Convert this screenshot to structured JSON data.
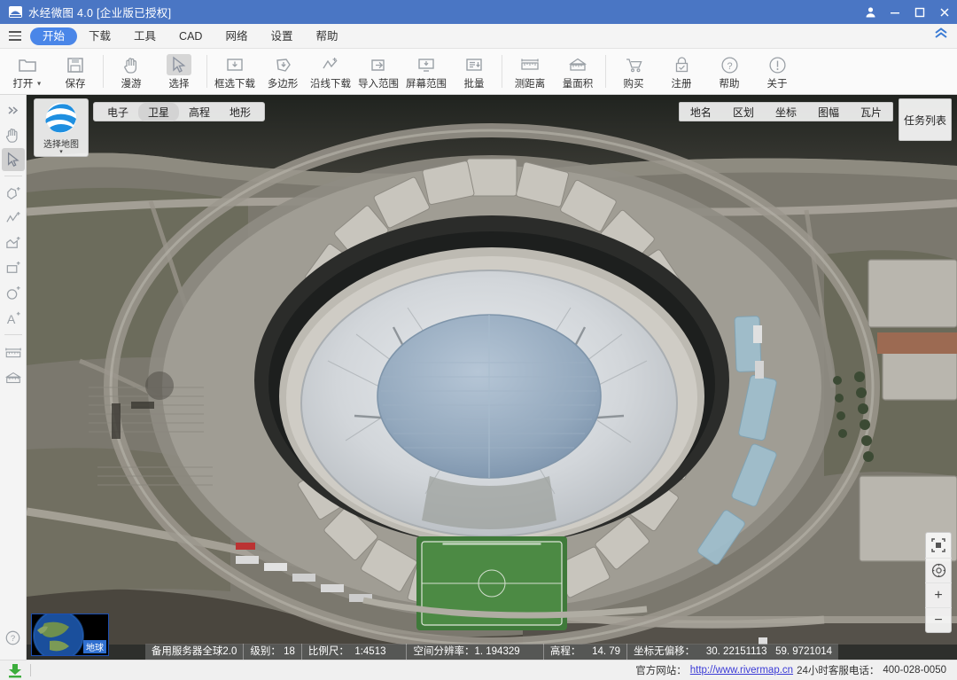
{
  "window": {
    "title": "水经微图 4.0 [企业版已授权]",
    "logo_icon": "app-logo-icon",
    "controls": [
      {
        "name": "user-account-icon",
        "glyph": "♟"
      },
      {
        "name": "minimize-button",
        "glyph": "—"
      },
      {
        "name": "maximize-button",
        "glyph": "□"
      },
      {
        "name": "close-button",
        "glyph": "✕"
      }
    ]
  },
  "menubar": {
    "hamburger_name": "hamburger-menu-icon",
    "items": [
      {
        "label": "开始",
        "active": true
      },
      {
        "label": "下载",
        "active": false
      },
      {
        "label": "工具",
        "active": false
      },
      {
        "label": "CAD",
        "active": false
      },
      {
        "label": "网络",
        "active": false
      },
      {
        "label": "设置",
        "active": false
      },
      {
        "label": "帮助",
        "active": false
      }
    ],
    "collapse_glyph": "∧̲"
  },
  "ribbon": {
    "items": [
      {
        "label": "打开",
        "icon": "folder-open-icon",
        "dropdown": true,
        "selected": false
      },
      {
        "label": "保存",
        "icon": "save-disk-icon",
        "dropdown": false,
        "selected": false
      },
      {
        "sep": true
      },
      {
        "label": "漫游",
        "icon": "pan-hand-icon",
        "dropdown": false,
        "selected": false
      },
      {
        "label": "选择",
        "icon": "select-arrow-icon",
        "dropdown": false,
        "selected": true
      },
      {
        "sep": true
      },
      {
        "label": "框选下载",
        "icon": "box-download-icon",
        "dropdown": false,
        "selected": false
      },
      {
        "label": "多边形",
        "icon": "polygon-download-icon",
        "dropdown": false,
        "selected": false
      },
      {
        "label": "沿线下载",
        "icon": "polyline-download-icon",
        "dropdown": false,
        "selected": false
      },
      {
        "label": "导入范围",
        "icon": "import-range-icon",
        "dropdown": false,
        "selected": false
      },
      {
        "label": "屏幕范围",
        "icon": "screen-range-icon",
        "dropdown": false,
        "selected": false
      },
      {
        "label": "批量",
        "icon": "batch-download-icon",
        "dropdown": false,
        "selected": false
      },
      {
        "sep": true
      },
      {
        "label": "测距离",
        "icon": "measure-distance-icon",
        "dropdown": false,
        "selected": false
      },
      {
        "label": "量面积",
        "icon": "measure-area-icon",
        "dropdown": false,
        "selected": false
      },
      {
        "sep": true
      },
      {
        "label": "购买",
        "icon": "cart-icon",
        "dropdown": false,
        "selected": false
      },
      {
        "label": "注册",
        "icon": "lock-register-icon",
        "dropdown": false,
        "selected": false
      },
      {
        "label": "帮助",
        "icon": "question-circle-icon",
        "dropdown": false,
        "selected": false
      },
      {
        "label": "关于",
        "icon": "info-circle-icon",
        "dropdown": false,
        "selected": false
      }
    ]
  },
  "left_toolbar": {
    "items": [
      {
        "icon": "expand-panel-icon",
        "selected": false
      },
      {
        "icon": "pan-hand-icon",
        "selected": false
      },
      {
        "icon": "select-arrow-icon",
        "selected": true
      },
      {
        "sep": true
      },
      {
        "icon": "add-polygon-icon",
        "selected": false
      },
      {
        "icon": "add-polyline-icon",
        "selected": false
      },
      {
        "icon": "add-area-icon",
        "selected": false
      },
      {
        "icon": "add-rectangle-icon",
        "selected": false
      },
      {
        "icon": "add-circle-icon",
        "selected": false
      },
      {
        "icon": "add-text-icon",
        "selected": false
      },
      {
        "sep": true
      },
      {
        "icon": "measure-distance-icon",
        "selected": false
      },
      {
        "icon": "measure-area-icon",
        "selected": false
      }
    ],
    "bottom": [
      {
        "icon": "help-circle-icon",
        "selected": false
      }
    ]
  },
  "map": {
    "select_map_button": {
      "label": "选择地图",
      "icon": "globe-icon",
      "caret": "▾"
    },
    "layer_tabs": [
      {
        "label": "电子",
        "selected": false
      },
      {
        "label": "卫星",
        "selected": true
      },
      {
        "label": "高程",
        "selected": false
      },
      {
        "label": "地形",
        "selected": false
      }
    ],
    "overlay_tabs": [
      {
        "label": "地名"
      },
      {
        "label": "区划"
      },
      {
        "label": "坐标"
      },
      {
        "label": "图幅"
      },
      {
        "label": "瓦片"
      }
    ],
    "task_list_label": "任务列表",
    "controls": [
      {
        "icon": "fit-extent-icon",
        "glyph": "⬚"
      },
      {
        "icon": "compass-target-icon",
        "glyph": "◎"
      },
      {
        "icon": "zoom-in-icon",
        "glyph": "+"
      },
      {
        "icon": "zoom-out-icon",
        "glyph": "−"
      }
    ],
    "minimap": {
      "label": "地球",
      "icon": "earth-thumbnail"
    },
    "status": {
      "server": "备用服务器全球2.0",
      "level_label": "级别：",
      "level_value": "18",
      "scale_label": "比例尺：",
      "scale_value": "1:4513",
      "resolution_label": "空间分辨率：",
      "resolution_value": "1. 194329",
      "elevation_label": "高程：",
      "elevation_value": "14. 79",
      "coord_label": "坐标无偏移：",
      "lon": "30. 22151113",
      "lat": "59. 9721014"
    }
  },
  "footer": {
    "download_icon": "download-arrow-icon",
    "site_label": "官方网站：",
    "site_url": "http://www.rivermap.cn",
    "service_label": "24小时客服电话：",
    "service_phone": "400-028-0050"
  },
  "colors": {
    "title_blue": "#4a76c4",
    "accent_blue": "#4a86e8",
    "ribbon_bg": "#fafafa",
    "link": "#3b3bd6",
    "download_green": "#3cad3c"
  }
}
